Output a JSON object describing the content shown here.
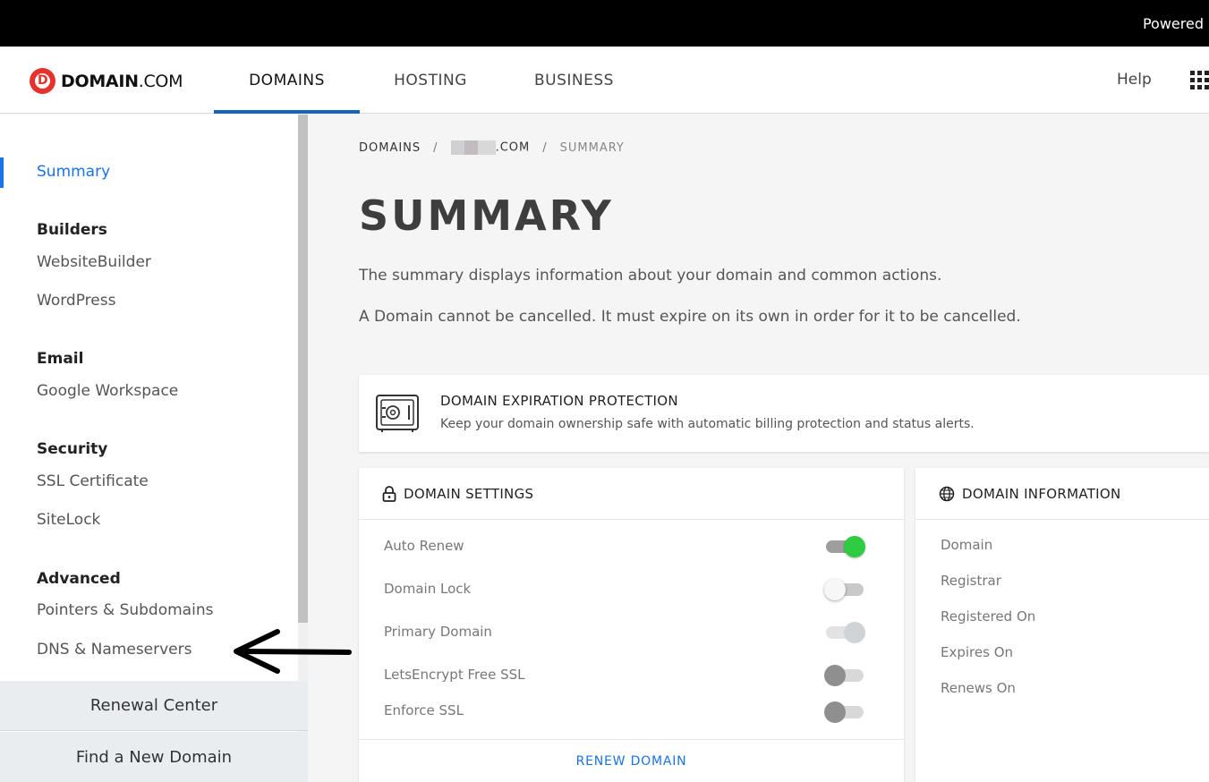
{
  "topbar": {
    "powered_text": "Powered"
  },
  "header": {
    "logo_brand": "DOMAIN",
    "logo_suffix": ".COM",
    "nav": [
      {
        "label": "DOMAINS",
        "active": true
      },
      {
        "label": "HOSTING",
        "active": false
      },
      {
        "label": "BUSINESS",
        "active": false
      }
    ],
    "help_label": "Help"
  },
  "sidebar": {
    "summary_label": "Summary",
    "sections": [
      {
        "heading": "Builders",
        "items": [
          "WebsiteBuilder",
          "WordPress"
        ]
      },
      {
        "heading": "Email",
        "items": [
          "Google Workspace"
        ]
      },
      {
        "heading": "Security",
        "items": [
          "SSL Certificate",
          "SiteLock"
        ]
      },
      {
        "heading": "Advanced",
        "items": [
          "Pointers & Subdomains",
          "DNS & Nameservers"
        ]
      }
    ],
    "renewal_center": "Renewal Center",
    "find_domain": "Find a New Domain"
  },
  "breadcrumb": {
    "root": "DOMAINS",
    "domain_suffix": ".COM",
    "current": "SUMMARY",
    "separator": "/"
  },
  "main": {
    "title": "SUMMARY",
    "desc1": "The summary displays information about your domain and common actions.",
    "desc2": "A Domain cannot be cancelled. It must expire on its own in order for it to be cancelled."
  },
  "protection": {
    "title": "DOMAIN EXPIRATION PROTECTION",
    "subtitle": "Keep your domain ownership safe with automatic billing protection and status alerts."
  },
  "settings": {
    "title": "DOMAIN SETTINGS",
    "rows": [
      {
        "label": "Auto Renew",
        "state": "on"
      },
      {
        "label": "Domain Lock",
        "state": "off"
      },
      {
        "label": "Primary Domain",
        "state": "disabled"
      },
      {
        "label": "LetsEncrypt Free SSL",
        "state": "gray"
      },
      {
        "label": "Enforce SSL",
        "state": "gray"
      }
    ],
    "renew_button": "RENEW DOMAIN"
  },
  "info": {
    "title": "DOMAIN INFORMATION",
    "labels": [
      "Domain",
      "Registrar",
      "Registered On",
      "Expires On",
      "Renews On"
    ]
  },
  "colors": {
    "accent": "#1a73e8",
    "nav_underline": "#1565c0",
    "logo_red": "#e5322d",
    "toggle_on": "#2ecc40"
  }
}
